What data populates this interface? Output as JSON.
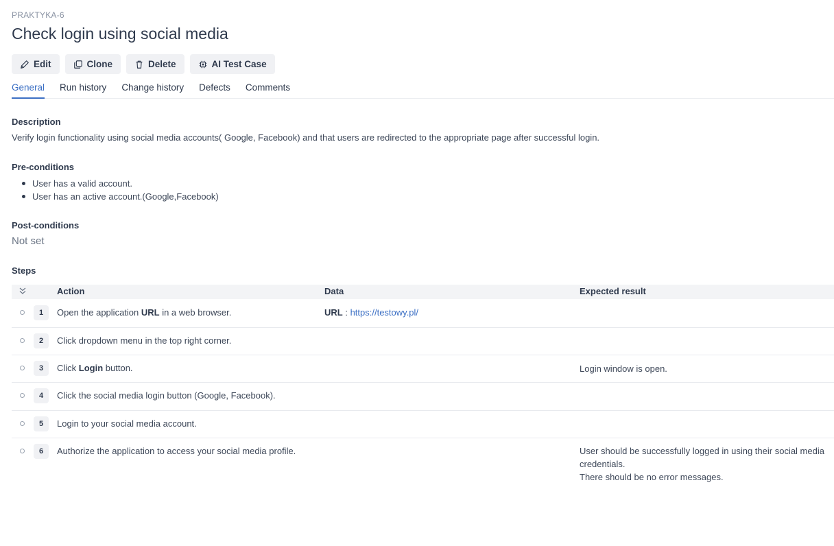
{
  "issue_key": "PRAKTYKA-6",
  "title": "Check login using social media",
  "toolbar": {
    "edit": "Edit",
    "clone": "Clone",
    "delete": "Delete",
    "ai": "AI Test Case"
  },
  "tabs": [
    "General",
    "Run history",
    "Change history",
    "Defects",
    "Comments"
  ],
  "description": {
    "label": "Description",
    "text": "Verify login functionality using social media accounts( Google, Facebook) and that users are redirected to the appropriate page after successful login."
  },
  "preconditions": {
    "label": "Pre-conditions",
    "items": [
      "User has a valid account.",
      "User has an active account.(Google,Facebook)"
    ]
  },
  "postconditions": {
    "label": "Post-conditions",
    "value": "Not set"
  },
  "steps": {
    "label": "Steps",
    "headers": {
      "action": "Action",
      "data": "Data",
      "expected": "Expected result"
    },
    "rows": [
      {
        "num": "1",
        "action_pre": "Open the application ",
        "action_bold": "URL",
        "action_post": " in a web browser.",
        "data_bold": "URL",
        "data_sep": " : ",
        "data_link": "https://testowy.pl/",
        "expected": ""
      },
      {
        "num": "2",
        "action_pre": "Click dropdown menu in the top right corner.",
        "action_bold": "",
        "action_post": "",
        "data_bold": "",
        "data_sep": "",
        "data_link": "",
        "expected": ""
      },
      {
        "num": "3",
        "action_pre": "Click ",
        "action_bold": "Login",
        "action_post": " button.",
        "data_bold": "",
        "data_sep": "",
        "data_link": "",
        "expected": "Login window is open."
      },
      {
        "num": "4",
        "action_pre": "Click the social media login button (Google, Facebook).",
        "action_bold": "",
        "action_post": "",
        "data_bold": "",
        "data_sep": "",
        "data_link": "",
        "expected": ""
      },
      {
        "num": "5",
        "action_pre": "Login to your social media account.",
        "action_bold": "",
        "action_post": "",
        "data_bold": "",
        "data_sep": "",
        "data_link": "",
        "expected": ""
      },
      {
        "num": "6",
        "action_pre": "Authorize the application to access your social media profile.",
        "action_bold": "",
        "action_post": "",
        "data_bold": "",
        "data_sep": "",
        "data_link": "",
        "expected": "User should be successfully logged in using their social media credentials.",
        "expected_2": "There should be no error messages."
      }
    ]
  }
}
